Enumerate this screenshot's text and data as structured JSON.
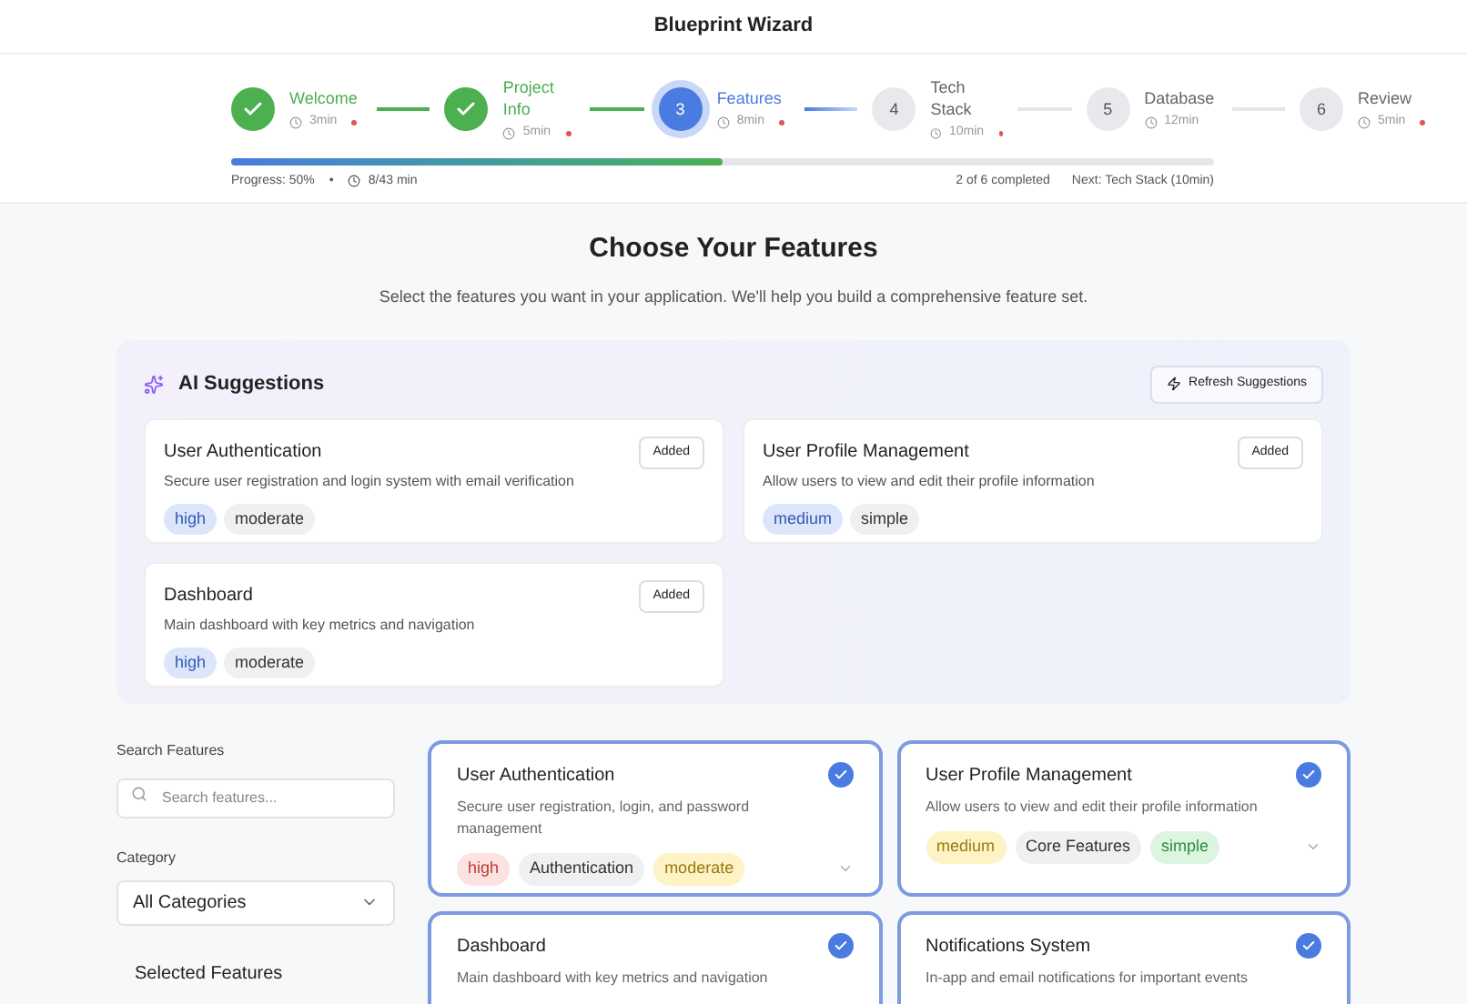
{
  "window": {
    "title": "Blueprint Wizard"
  },
  "steps": [
    {
      "label": "Welcome",
      "time": "3min",
      "required": true,
      "completed": true,
      "current": false
    },
    {
      "label": "Project Info",
      "time": "5min",
      "required": true,
      "completed": true,
      "current": false
    },
    {
      "number": "3",
      "label": "Features",
      "time": "8min",
      "required": true,
      "completed": false,
      "current": true
    },
    {
      "number": "4",
      "label": "Tech Stack",
      "time": "10min",
      "required": true,
      "completed": false,
      "current": false
    },
    {
      "number": "5",
      "label": "Database",
      "time": "12min",
      "required": false,
      "completed": false,
      "current": false
    },
    {
      "number": "6",
      "label": "Review",
      "time": "5min",
      "required": true,
      "completed": false,
      "current": false
    }
  ],
  "progress": {
    "level": 0.5,
    "label": "Progress: 50%",
    "separator": "•",
    "time": "8/43 min",
    "completed": "2 of 6 completed",
    "next": "Next: Tech Stack (10min)"
  },
  "heading": "Choose Your Features",
  "subheading": "Select the features you want in your application. We'll help you build a comprehensive feature set.",
  "ai_suggestions": {
    "title": "AI Suggestions",
    "refresh_button": "Refresh Suggestions",
    "items": [
      {
        "title": "User Authentication",
        "description": "Secure user registration and login system with email verification",
        "button": "Added",
        "tags": [
          {
            "text": "high",
            "color": "#dbe6fb"
          },
          {
            "text": "moderate",
            "color": "#f0f0f2"
          }
        ]
      },
      {
        "title": "User Profile Management",
        "description": "Allow users to view and edit their profile information",
        "button": "Added",
        "tags": [
          {
            "text": "medium",
            "color": "#dbe6fb"
          },
          {
            "text": "simple",
            "color": "#f0f0f2"
          }
        ]
      },
      {
        "title": "Dashboard",
        "description": "Main dashboard with key metrics and navigation",
        "button": "Added",
        "tags": [
          {
            "text": "high",
            "color": "#dbe6fb"
          },
          {
            "text": "moderate",
            "color": "#f0f0f2"
          }
        ]
      }
    ]
  },
  "filters": {
    "search_label": "Search Features",
    "search_placeholder": "Search features...",
    "category_label": "Category",
    "category_value": "All Categories",
    "selected_title": "Selected Features"
  },
  "features": [
    {
      "title": "User Authentication",
      "description": "Secure user registration, login, and password management",
      "selected": true,
      "tags": [
        {
          "text": "high",
          "color": "#fde2e2"
        },
        {
          "text": "Authentication",
          "color": "#f0f0f2"
        },
        {
          "text": "moderate",
          "color": "#fdf3c4"
        }
      ]
    },
    {
      "title": "User Profile Management",
      "description": "Allow users to view and edit their profile information",
      "selected": true,
      "tags": [
        {
          "text": "medium",
          "color": "#fdf3c4"
        },
        {
          "text": "Core Features",
          "color": "#f0f0f2"
        },
        {
          "text": "simple",
          "color": "#dcf5e0"
        }
      ]
    },
    {
      "title": "Dashboard",
      "description": "Main dashboard with key metrics and navigation",
      "selected": true
    },
    {
      "title": "Notifications System",
      "description": "In-app and email notifications for important events",
      "selected": true
    }
  ]
}
